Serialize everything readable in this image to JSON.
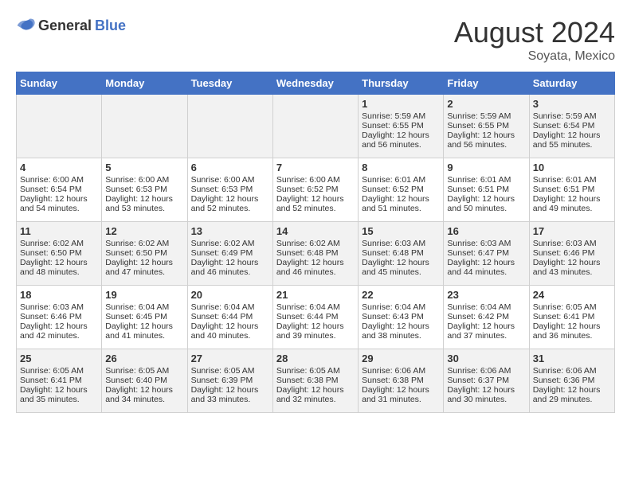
{
  "logo": {
    "general": "General",
    "blue": "Blue"
  },
  "title": "August 2024",
  "subtitle": "Soyata, Mexico",
  "days_of_week": [
    "Sunday",
    "Monday",
    "Tuesday",
    "Wednesday",
    "Thursday",
    "Friday",
    "Saturday"
  ],
  "weeks": [
    [
      {
        "day": "",
        "sunrise": "",
        "sunset": "",
        "daylight": ""
      },
      {
        "day": "",
        "sunrise": "",
        "sunset": "",
        "daylight": ""
      },
      {
        "day": "",
        "sunrise": "",
        "sunset": "",
        "daylight": ""
      },
      {
        "day": "",
        "sunrise": "",
        "sunset": "",
        "daylight": ""
      },
      {
        "day": "1",
        "sunrise": "Sunrise: 5:59 AM",
        "sunset": "Sunset: 6:55 PM",
        "daylight": "Daylight: 12 hours and 56 minutes."
      },
      {
        "day": "2",
        "sunrise": "Sunrise: 5:59 AM",
        "sunset": "Sunset: 6:55 PM",
        "daylight": "Daylight: 12 hours and 56 minutes."
      },
      {
        "day": "3",
        "sunrise": "Sunrise: 5:59 AM",
        "sunset": "Sunset: 6:54 PM",
        "daylight": "Daylight: 12 hours and 55 minutes."
      }
    ],
    [
      {
        "day": "4",
        "sunrise": "Sunrise: 6:00 AM",
        "sunset": "Sunset: 6:54 PM",
        "daylight": "Daylight: 12 hours and 54 minutes."
      },
      {
        "day": "5",
        "sunrise": "Sunrise: 6:00 AM",
        "sunset": "Sunset: 6:53 PM",
        "daylight": "Daylight: 12 hours and 53 minutes."
      },
      {
        "day": "6",
        "sunrise": "Sunrise: 6:00 AM",
        "sunset": "Sunset: 6:53 PM",
        "daylight": "Daylight: 12 hours and 52 minutes."
      },
      {
        "day": "7",
        "sunrise": "Sunrise: 6:00 AM",
        "sunset": "Sunset: 6:52 PM",
        "daylight": "Daylight: 12 hours and 52 minutes."
      },
      {
        "day": "8",
        "sunrise": "Sunrise: 6:01 AM",
        "sunset": "Sunset: 6:52 PM",
        "daylight": "Daylight: 12 hours and 51 minutes."
      },
      {
        "day": "9",
        "sunrise": "Sunrise: 6:01 AM",
        "sunset": "Sunset: 6:51 PM",
        "daylight": "Daylight: 12 hours and 50 minutes."
      },
      {
        "day": "10",
        "sunrise": "Sunrise: 6:01 AM",
        "sunset": "Sunset: 6:51 PM",
        "daylight": "Daylight: 12 hours and 49 minutes."
      }
    ],
    [
      {
        "day": "11",
        "sunrise": "Sunrise: 6:02 AM",
        "sunset": "Sunset: 6:50 PM",
        "daylight": "Daylight: 12 hours and 48 minutes."
      },
      {
        "day": "12",
        "sunrise": "Sunrise: 6:02 AM",
        "sunset": "Sunset: 6:50 PM",
        "daylight": "Daylight: 12 hours and 47 minutes."
      },
      {
        "day": "13",
        "sunrise": "Sunrise: 6:02 AM",
        "sunset": "Sunset: 6:49 PM",
        "daylight": "Daylight: 12 hours and 46 minutes."
      },
      {
        "day": "14",
        "sunrise": "Sunrise: 6:02 AM",
        "sunset": "Sunset: 6:48 PM",
        "daylight": "Daylight: 12 hours and 46 minutes."
      },
      {
        "day": "15",
        "sunrise": "Sunrise: 6:03 AM",
        "sunset": "Sunset: 6:48 PM",
        "daylight": "Daylight: 12 hours and 45 minutes."
      },
      {
        "day": "16",
        "sunrise": "Sunrise: 6:03 AM",
        "sunset": "Sunset: 6:47 PM",
        "daylight": "Daylight: 12 hours and 44 minutes."
      },
      {
        "day": "17",
        "sunrise": "Sunrise: 6:03 AM",
        "sunset": "Sunset: 6:46 PM",
        "daylight": "Daylight: 12 hours and 43 minutes."
      }
    ],
    [
      {
        "day": "18",
        "sunrise": "Sunrise: 6:03 AM",
        "sunset": "Sunset: 6:46 PM",
        "daylight": "Daylight: 12 hours and 42 minutes."
      },
      {
        "day": "19",
        "sunrise": "Sunrise: 6:04 AM",
        "sunset": "Sunset: 6:45 PM",
        "daylight": "Daylight: 12 hours and 41 minutes."
      },
      {
        "day": "20",
        "sunrise": "Sunrise: 6:04 AM",
        "sunset": "Sunset: 6:44 PM",
        "daylight": "Daylight: 12 hours and 40 minutes."
      },
      {
        "day": "21",
        "sunrise": "Sunrise: 6:04 AM",
        "sunset": "Sunset: 6:44 PM",
        "daylight": "Daylight: 12 hours and 39 minutes."
      },
      {
        "day": "22",
        "sunrise": "Sunrise: 6:04 AM",
        "sunset": "Sunset: 6:43 PM",
        "daylight": "Daylight: 12 hours and 38 minutes."
      },
      {
        "day": "23",
        "sunrise": "Sunrise: 6:04 AM",
        "sunset": "Sunset: 6:42 PM",
        "daylight": "Daylight: 12 hours and 37 minutes."
      },
      {
        "day": "24",
        "sunrise": "Sunrise: 6:05 AM",
        "sunset": "Sunset: 6:41 PM",
        "daylight": "Daylight: 12 hours and 36 minutes."
      }
    ],
    [
      {
        "day": "25",
        "sunrise": "Sunrise: 6:05 AM",
        "sunset": "Sunset: 6:41 PM",
        "daylight": "Daylight: 12 hours and 35 minutes."
      },
      {
        "day": "26",
        "sunrise": "Sunrise: 6:05 AM",
        "sunset": "Sunset: 6:40 PM",
        "daylight": "Daylight: 12 hours and 34 minutes."
      },
      {
        "day": "27",
        "sunrise": "Sunrise: 6:05 AM",
        "sunset": "Sunset: 6:39 PM",
        "daylight": "Daylight: 12 hours and 33 minutes."
      },
      {
        "day": "28",
        "sunrise": "Sunrise: 6:05 AM",
        "sunset": "Sunset: 6:38 PM",
        "daylight": "Daylight: 12 hours and 32 minutes."
      },
      {
        "day": "29",
        "sunrise": "Sunrise: 6:06 AM",
        "sunset": "Sunset: 6:38 PM",
        "daylight": "Daylight: 12 hours and 31 minutes."
      },
      {
        "day": "30",
        "sunrise": "Sunrise: 6:06 AM",
        "sunset": "Sunset: 6:37 PM",
        "daylight": "Daylight: 12 hours and 30 minutes."
      },
      {
        "day": "31",
        "sunrise": "Sunrise: 6:06 AM",
        "sunset": "Sunset: 6:36 PM",
        "daylight": "Daylight: 12 hours and 29 minutes."
      }
    ]
  ]
}
